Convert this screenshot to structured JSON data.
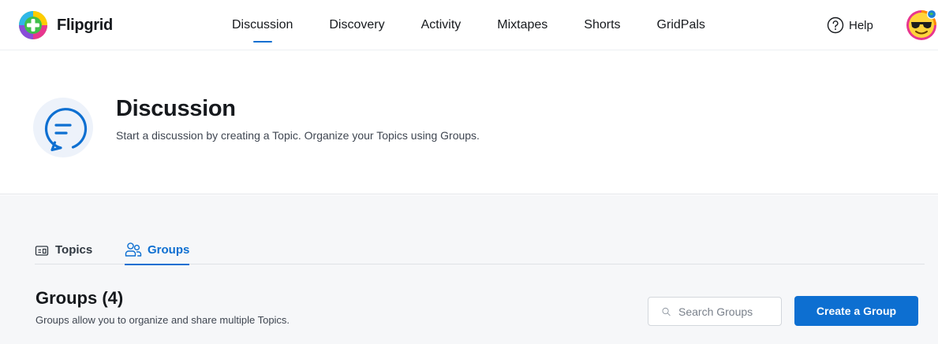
{
  "brand": {
    "name": "Flipgrid",
    "logo_icon": "flipgrid-logo-icon"
  },
  "nav": {
    "items": [
      {
        "label": "Discussion",
        "active": true
      },
      {
        "label": "Discovery",
        "active": false
      },
      {
        "label": "Activity",
        "active": false
      },
      {
        "label": "Mixtapes",
        "active": false
      },
      {
        "label": "Shorts",
        "active": false
      },
      {
        "label": "GridPals",
        "active": false
      }
    ],
    "help_label": "Help",
    "help_icon": "question-circle-icon",
    "avatar_icon": "sunglasses-emoji-avatar"
  },
  "header": {
    "title": "Discussion",
    "subtitle": "Start a discussion by creating a Topic. Organize your Topics using Groups.",
    "icon": "chat-bubble-icon"
  },
  "tabs": [
    {
      "label": "Topics",
      "icon": "topics-card-icon",
      "active": false
    },
    {
      "label": "Groups",
      "icon": "groups-people-icon",
      "active": true
    }
  ],
  "groups": {
    "title": "Groups (4)",
    "description": "Groups allow you to organize and share multiple Topics.",
    "search_placeholder": "Search Groups",
    "search_value": "",
    "create_label": "Create a Group"
  },
  "colors": {
    "accent": "#0d6fd1",
    "text": "#16191d",
    "muted": "#3f4651",
    "content_bg": "#f6f7f9",
    "badge_bg": "#edf2fa"
  }
}
